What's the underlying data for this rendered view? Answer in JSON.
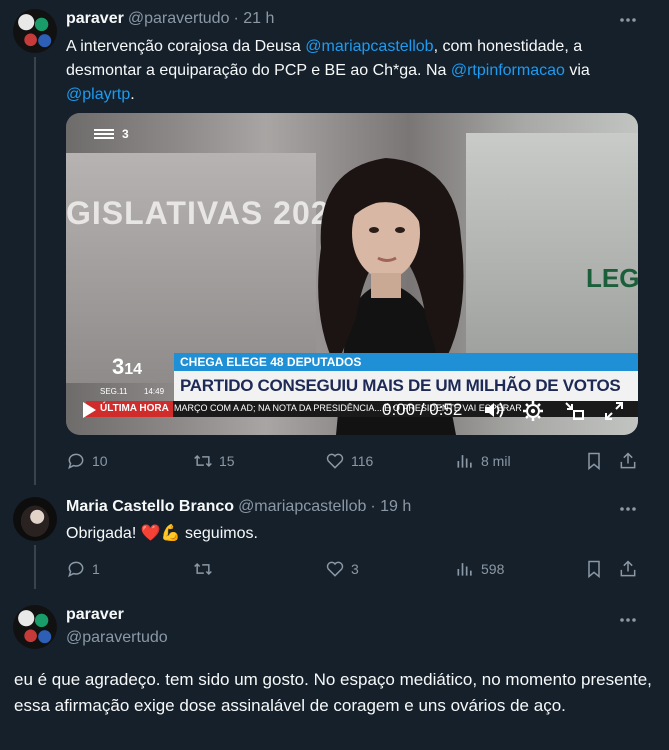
{
  "tweet1": {
    "name": "paraver",
    "handle": "@paravertudo",
    "time": "· 21 h",
    "text_a": "A intervenção corajosa da Deusa ",
    "mention1": "@mariapcastellob",
    "text_b": ", com honestidade, a desmontar a equiparação do PCP e BE ao Ch*ga. Na ",
    "mention2": "@rtpinformacao",
    "text_c": " via ",
    "mention3": "@playrtp",
    "text_d": ".",
    "video": {
      "channel": "3",
      "bg_text": "GISLATIVAS 2024",
      "headline": "CHEGA ELEGE 48 DEPUTADOS",
      "subline": "PARTIDO CONSEGUIU MAIS DE UM MILHÃO DE VOTOS",
      "logo_num": "3",
      "logo_sub": "14",
      "date": "SEG.11",
      "clock": "14:49",
      "ticker_label": "ÚLTIMA HORA",
      "ticker_text": "MARÇO COM A AD; NA NOTA DA PRESIDÊNCIA... É O PRESIDENTE VAI ESPERAR",
      "timestamp": "0:00 / 0:52",
      "side_text": "LEG"
    },
    "replies": "10",
    "retweets": "15",
    "likes": "116",
    "views": "8 mil"
  },
  "tweet2": {
    "name": "Maria Castello Branco",
    "handle": "@mariapcastellob",
    "time": "· 19 h",
    "text": "Obrigada! ",
    "emoji_heart": "❤️",
    "emoji_flex": "💪",
    "text_after": " seguimos.",
    "replies": "1",
    "retweets": "",
    "likes": "3",
    "views": "598"
  },
  "tweet3": {
    "name": "paraver",
    "handle": "@paravertudo",
    "text": "eu é que agradeço. tem sido um gosto. No espaço mediático, no momento presente, essa afirmação exige dose assinalável de coragem e uns ovários de aço."
  },
  "icons": {
    "more": "more-dots-icon",
    "reply": "reply-icon",
    "retweet": "retweet-icon",
    "like": "heart-icon",
    "views": "views-icon",
    "bookmark": "bookmark-icon",
    "share": "share-icon"
  },
  "colors": {
    "background": "#15202b",
    "link": "#1d9bf0",
    "muted": "#8b98a5"
  }
}
